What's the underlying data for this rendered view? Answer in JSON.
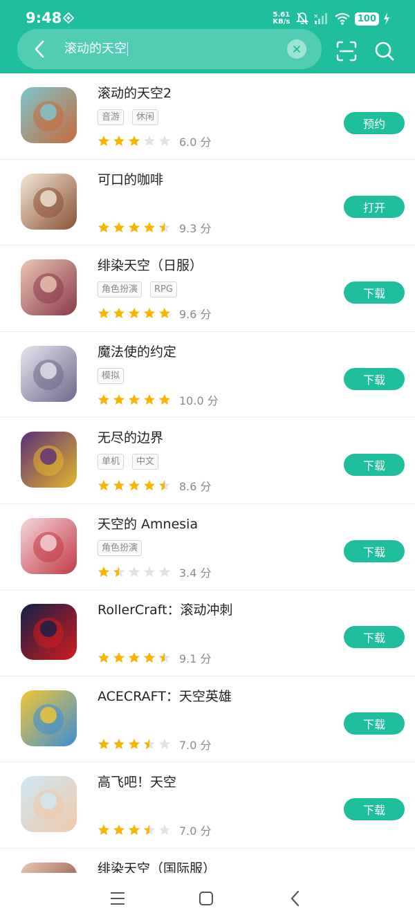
{
  "status": {
    "time": "9:48",
    "net_speed_value": "5.61",
    "net_speed_unit": "KB/s",
    "battery": "100"
  },
  "search": {
    "query": "滚动的天空"
  },
  "results": [
    {
      "name": "滚动的天空2",
      "tags": [
        "音游",
        "休闲"
      ],
      "rating": 3,
      "score": "6.0 分",
      "action": "预约",
      "icon_colors": [
        "#7cc7cf",
        "#c96a3a"
      ]
    },
    {
      "name": "可口的咖啡",
      "tags": [],
      "rating": 4.5,
      "score": "9.3 分",
      "action": "打开",
      "icon_colors": [
        "#f3e6d6",
        "#8a5234"
      ]
    },
    {
      "name": "绯染天空（日服）",
      "tags": [
        "角色扮演",
        "RPG"
      ],
      "rating": 5,
      "score": "9.6 分",
      "action": "下载",
      "icon_colors": [
        "#e9c7b3",
        "#8b3a4a"
      ]
    },
    {
      "name": "魔法使的约定",
      "tags": [
        "模拟"
      ],
      "rating": 5,
      "score": "10.0 分",
      "action": "下载",
      "icon_colors": [
        "#e6e3ef",
        "#6e6a8d"
      ]
    },
    {
      "name": "无尽的边界",
      "tags": [
        "单机",
        "中文"
      ],
      "rating": 4.5,
      "score": "8.6 分",
      "action": "下载",
      "icon_colors": [
        "#5a2f7a",
        "#e3b52a"
      ]
    },
    {
      "name": "天空的 Amnesia",
      "tags": [
        "角色扮演"
      ],
      "rating": 1.5,
      "score": "3.4 分",
      "action": "下载",
      "icon_colors": [
        "#f4d7dc",
        "#c23a45"
      ]
    },
    {
      "name": "RollerCraft：滚动冲刺",
      "tags": [],
      "rating": 4.5,
      "score": "9.1 分",
      "action": "下载",
      "icon_colors": [
        "#10204a",
        "#d21c1c"
      ]
    },
    {
      "name": "ACECRAFT：天空英雄",
      "tags": [],
      "rating": 3.5,
      "score": "7.0 分",
      "action": "下载",
      "icon_colors": [
        "#f5c634",
        "#3b8fd6"
      ]
    },
    {
      "name": "高飞吧！天空",
      "tags": [],
      "rating": 3.5,
      "score": "7.0 分",
      "action": "下载",
      "icon_colors": [
        "#cfe8f6",
        "#f1c9a8"
      ]
    },
    {
      "name": "绯染天空（国际服）",
      "tags": [],
      "rating": 0,
      "score": "",
      "action": "",
      "icon_colors": [
        "#e9c7b3",
        "#7a3a2a"
      ]
    }
  ],
  "colors": {
    "accent": "#1fbf9e",
    "star_filled": "#f7b500",
    "star_empty": "#e3e3e3"
  }
}
